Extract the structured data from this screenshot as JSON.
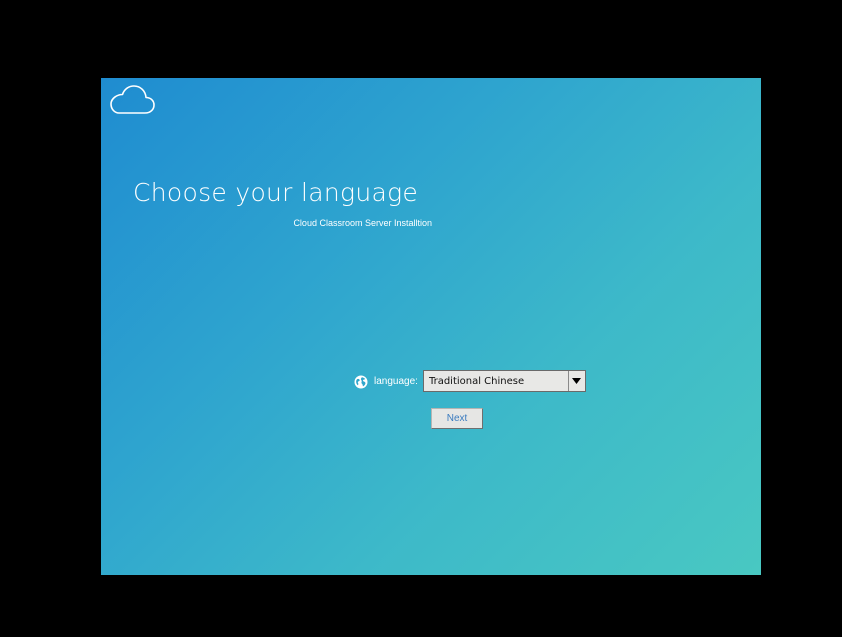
{
  "header": {
    "logo_icon": "cloud-icon",
    "title": "Choose your language",
    "subtitle": "Cloud Classroom Server Installtion"
  },
  "language": {
    "icon": "globe-icon",
    "label": "language:",
    "selected": "Traditional Chinese"
  },
  "actions": {
    "next_label": "Next"
  },
  "colors": {
    "gradient_start": "#1f8cd0",
    "gradient_end": "#49c8c2",
    "next_text": "#3a7bbf"
  }
}
